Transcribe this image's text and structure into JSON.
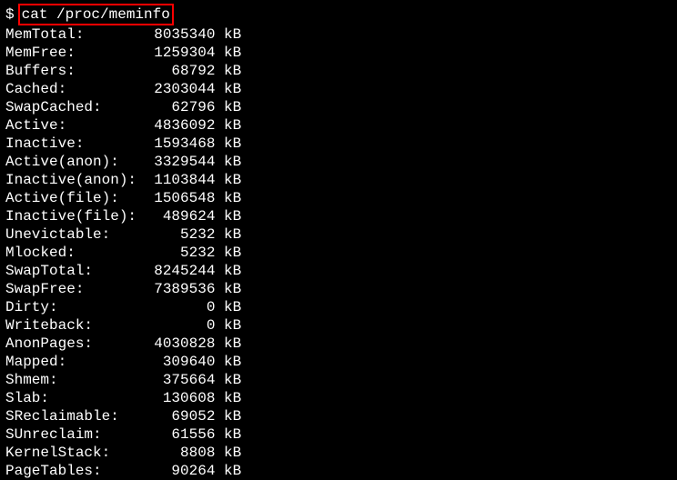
{
  "prompt": "$",
  "command": "cat /proc/meminfo",
  "unit": "kB",
  "rows": [
    {
      "label": "MemTotal:",
      "value": "8035340"
    },
    {
      "label": "MemFree:",
      "value": "1259304"
    },
    {
      "label": "Buffers:",
      "value": "68792"
    },
    {
      "label": "Cached:",
      "value": "2303044"
    },
    {
      "label": "SwapCached:",
      "value": "62796"
    },
    {
      "label": "Active:",
      "value": "4836092"
    },
    {
      "label": "Inactive:",
      "value": "1593468"
    },
    {
      "label": "Active(anon):",
      "value": "3329544"
    },
    {
      "label": "Inactive(anon):",
      "value": "1103844"
    },
    {
      "label": "Active(file):",
      "value": "1506548"
    },
    {
      "label": "Inactive(file):",
      "value": "489624"
    },
    {
      "label": "Unevictable:",
      "value": "5232"
    },
    {
      "label": "Mlocked:",
      "value": "5232"
    },
    {
      "label": "SwapTotal:",
      "value": "8245244"
    },
    {
      "label": "SwapFree:",
      "value": "7389536"
    },
    {
      "label": "Dirty:",
      "value": "0"
    },
    {
      "label": "Writeback:",
      "value": "0"
    },
    {
      "label": "AnonPages:",
      "value": "4030828"
    },
    {
      "label": "Mapped:",
      "value": "309640"
    },
    {
      "label": "Shmem:",
      "value": "375664"
    },
    {
      "label": "Slab:",
      "value": "130608"
    },
    {
      "label": "SReclaimable:",
      "value": "69052"
    },
    {
      "label": "SUnreclaim:",
      "value": "61556"
    },
    {
      "label": "KernelStack:",
      "value": "8808"
    },
    {
      "label": "PageTables:",
      "value": "90264"
    }
  ]
}
